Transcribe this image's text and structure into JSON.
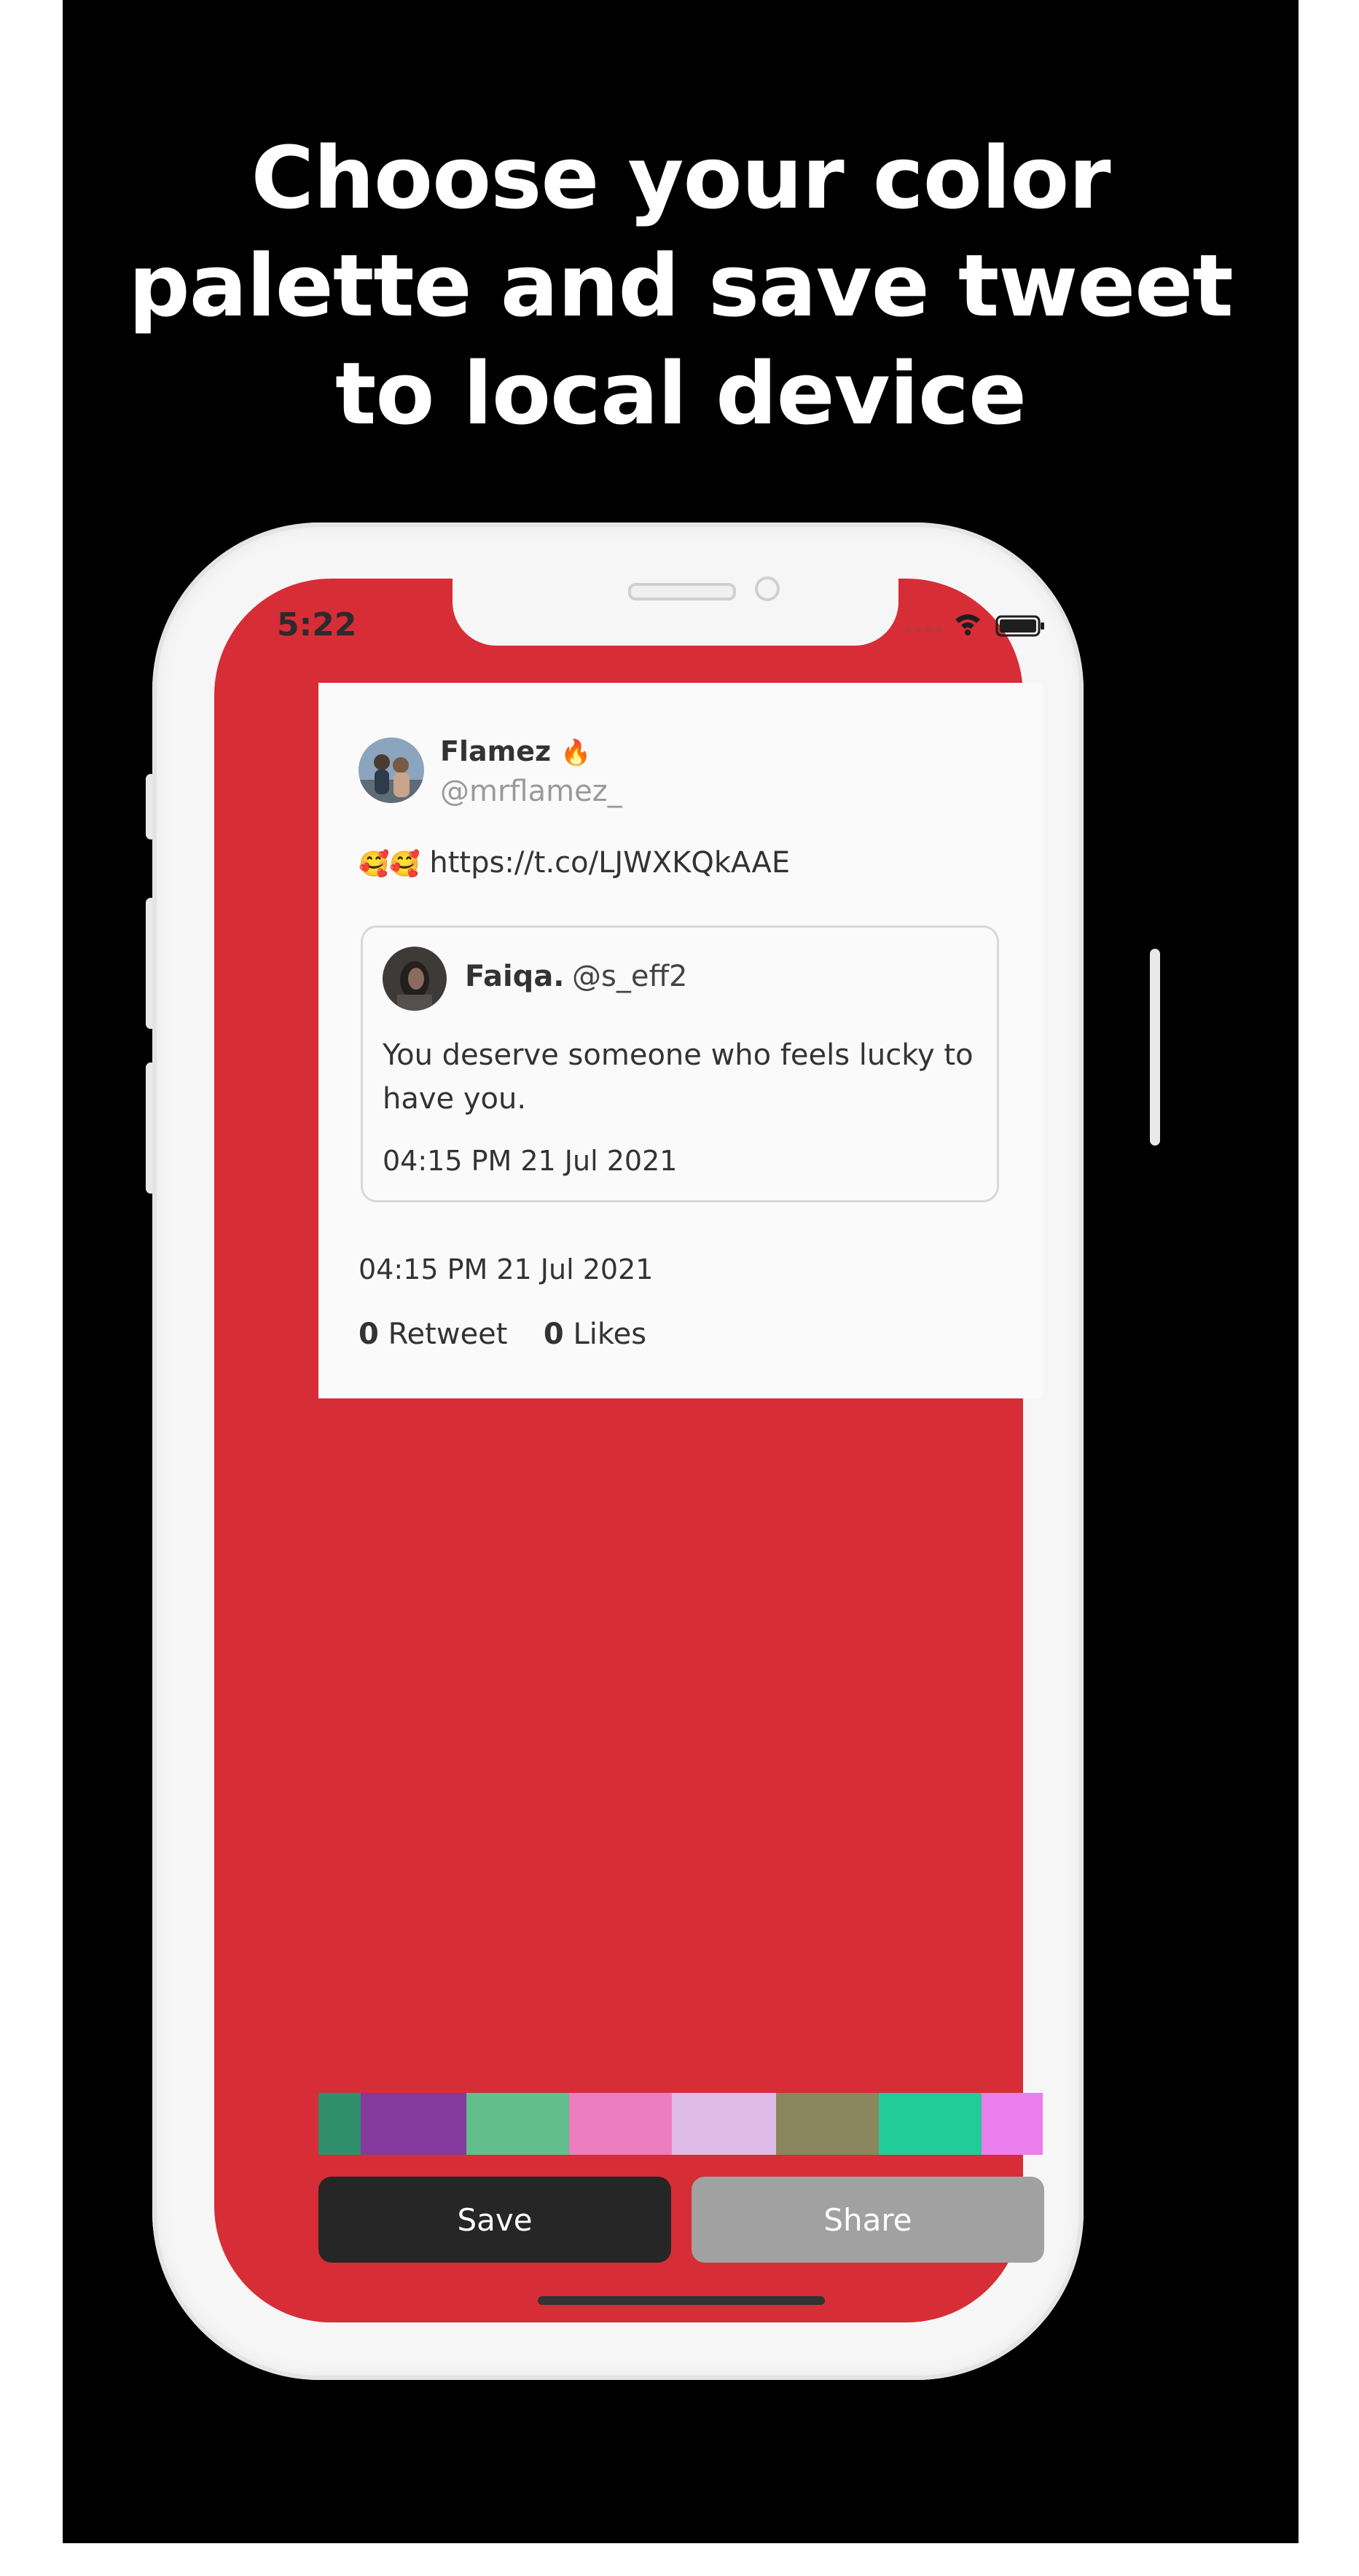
{
  "headline": {
    "line1": "Choose your color",
    "line2": "palette and save tweet",
    "line3": "to local device"
  },
  "status_bar": {
    "time": "5:22"
  },
  "tweet": {
    "author_name": "Flamez",
    "author_emoji": "🔥",
    "author_handle": "@mrflamez_",
    "text_emoji": "🥰🥰",
    "text_link": "https://t.co/LJWXKQkAAE",
    "quoted": {
      "author_name": "Faiqa.",
      "author_handle": "@s_eff2",
      "text_line1": "You deserve someone who feels lucky to",
      "text_line2": "have you.",
      "timestamp": "04:15 PM 21 Jul 2021"
    },
    "timestamp": "04:15 PM 21 Jul 2021",
    "retweet_count": "0",
    "retweet_label": "Retweet",
    "likes_count": "0",
    "likes_label": "Likes"
  },
  "palette": {
    "background_color": "#d62d37",
    "swatches": [
      "#2e8f6a",
      "#853a9e",
      "#62be8c",
      "#ee7dbf",
      "#dfbbe8",
      "#8a875e",
      "#22cc9a",
      "#ec7ded"
    ]
  },
  "actions": {
    "save_label": "Save",
    "share_label": "Share"
  }
}
